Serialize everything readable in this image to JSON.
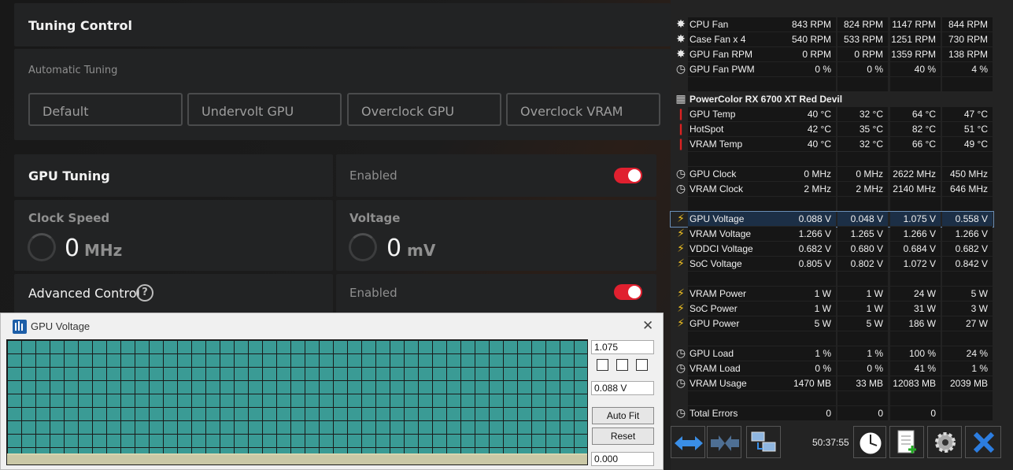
{
  "tuning": {
    "title": "Tuning Control",
    "auto_label": "Automatic Tuning",
    "buttons": [
      "Default",
      "Undervolt GPU",
      "Overclock GPU",
      "Overclock VRAM"
    ],
    "gpu_tuning_label": "GPU Tuning",
    "gpu_tuning_state": "Enabled",
    "clock_label": "Clock Speed",
    "clock_value": "0",
    "clock_unit": "MHz",
    "voltage_label": "Voltage",
    "voltage_value": "0",
    "voltage_unit": "mV",
    "advanced_label": "Advanced Control",
    "advanced_state": "Enabled",
    "help_glyph": "?",
    "toggle_color": "#e0202f"
  },
  "graph_window": {
    "title": "GPU Voltage",
    "max_value": "1.075",
    "current_value": "0.088 V",
    "min_value": "0.000",
    "autofit_label": "Auto Fit",
    "reset_label": "Reset",
    "close_glyph": "✕",
    "graph_color": "#3a9b95"
  },
  "sensors": {
    "rows": [
      {
        "icon": "fan",
        "name": "CPU Fan",
        "v": [
          "843 RPM",
          "824 RPM",
          "1147 RPM",
          "844 RPM"
        ]
      },
      {
        "icon": "fan",
        "name": "Case Fan x 4",
        "v": [
          "540 RPM",
          "533 RPM",
          "1251 RPM",
          "730 RPM"
        ]
      },
      {
        "icon": "fan",
        "name": "GPU Fan RPM",
        "v": [
          "0 RPM",
          "0 RPM",
          "1359 RPM",
          "138 RPM"
        ]
      },
      {
        "icon": "clock",
        "name": "GPU Fan PWM",
        "v": [
          "0 %",
          "0 %",
          "40 %",
          "4 %"
        ]
      },
      {
        "icon": "",
        "name": "",
        "v": [
          "",
          "",
          "",
          ""
        ]
      },
      {
        "icon": "chip",
        "name": "PowerColor RX 6700 XT Red Devil",
        "header": true
      },
      {
        "icon": "temp",
        "name": "GPU Temp",
        "v": [
          "40 °C",
          "32 °C",
          "64 °C",
          "47 °C"
        ]
      },
      {
        "icon": "temp",
        "name": "HotSpot",
        "v": [
          "42 °C",
          "35 °C",
          "82 °C",
          "51 °C"
        ]
      },
      {
        "icon": "temp",
        "name": "VRAM Temp",
        "v": [
          "40 °C",
          "32 °C",
          "66 °C",
          "49 °C"
        ]
      },
      {
        "icon": "",
        "name": "",
        "v": [
          "",
          "",
          "",
          ""
        ]
      },
      {
        "icon": "clock",
        "name": "GPU Clock",
        "v": [
          "0 MHz",
          "0 MHz",
          "2622 MHz",
          "450 MHz"
        ]
      },
      {
        "icon": "clock",
        "name": "VRAM Clock",
        "v": [
          "2 MHz",
          "2 MHz",
          "2140 MHz",
          "646 MHz"
        ]
      },
      {
        "icon": "",
        "name": "",
        "v": [
          "",
          "",
          "",
          ""
        ]
      },
      {
        "icon": "bolt",
        "name": "GPU Voltage",
        "v": [
          "0.088 V",
          "0.048 V",
          "1.075 V",
          "0.558 V"
        ],
        "selected": true
      },
      {
        "icon": "bolt",
        "name": "VRAM Voltage",
        "v": [
          "1.266 V",
          "1.265 V",
          "1.266 V",
          "1.266 V"
        ]
      },
      {
        "icon": "bolt",
        "name": "VDDCI Voltage",
        "v": [
          "0.682 V",
          "0.680 V",
          "0.684 V",
          "0.682 V"
        ]
      },
      {
        "icon": "bolt",
        "name": "SoC Voltage",
        "v": [
          "0.805 V",
          "0.802 V",
          "1.072 V",
          "0.842 V"
        ]
      },
      {
        "icon": "",
        "name": "",
        "v": [
          "",
          "",
          "",
          ""
        ]
      },
      {
        "icon": "bolt",
        "name": "VRAM Power",
        "v": [
          "1 W",
          "1 W",
          "24 W",
          "5 W"
        ]
      },
      {
        "icon": "bolt",
        "name": "SoC Power",
        "v": [
          "1 W",
          "1 W",
          "31 W",
          "3 W"
        ]
      },
      {
        "icon": "bolt",
        "name": "GPU Power",
        "v": [
          "5 W",
          "5 W",
          "186 W",
          "27 W"
        ]
      },
      {
        "icon": "",
        "name": "",
        "v": [
          "",
          "",
          "",
          ""
        ]
      },
      {
        "icon": "clock",
        "name": "GPU Load",
        "v": [
          "1 %",
          "1 %",
          "100 %",
          "24 %"
        ]
      },
      {
        "icon": "clock",
        "name": "VRAM Load",
        "v": [
          "0 %",
          "0 %",
          "41 %",
          "1 %"
        ]
      },
      {
        "icon": "clock",
        "name": "VRAM Usage",
        "v": [
          "1470 MB",
          "33 MB",
          "12083 MB",
          "2039 MB"
        ]
      },
      {
        "icon": "",
        "name": "",
        "v": [
          "",
          "",
          "",
          ""
        ]
      },
      {
        "icon": "clock",
        "name": "Total Errors",
        "v": [
          "0",
          "0",
          "0",
          ""
        ]
      }
    ]
  },
  "toolbar": {
    "elapsed": "50:37:55"
  }
}
